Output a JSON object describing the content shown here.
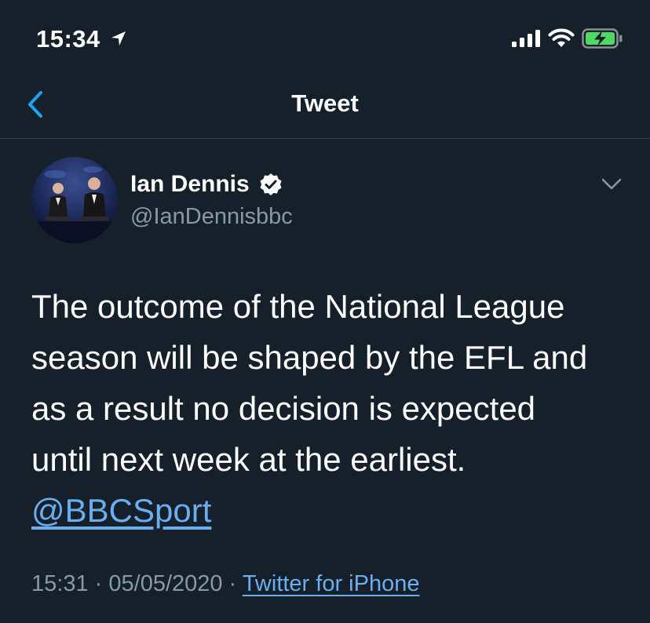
{
  "status_bar": {
    "time": "15:34",
    "icons": [
      "location-arrow-icon",
      "cellular-signal-icon",
      "wifi-icon",
      "battery-charging-icon"
    ]
  },
  "nav": {
    "title": "Tweet",
    "back_icon": "back-chevron-icon"
  },
  "tweet": {
    "author": {
      "name": "Ian Dennis",
      "handle": "@IanDennisbbc",
      "verified": true
    },
    "text_lines": [
      "The outcome of the National League",
      "season will be shaped by the EFL and",
      "as a result no decision is expected",
      "until next week at the earliest."
    ],
    "mention": "@BBCSport",
    "time": "15:31",
    "separator": "·",
    "date": "05/05/2020",
    "source": "Twitter for iPhone"
  },
  "colors": {
    "background": "#15202b",
    "divider": "#38444d",
    "text_primary": "#ffffff",
    "text_secondary": "#8899a6",
    "link": "#6aaef0",
    "accent": "#1da1f2",
    "battery_green": "#4cd964"
  }
}
